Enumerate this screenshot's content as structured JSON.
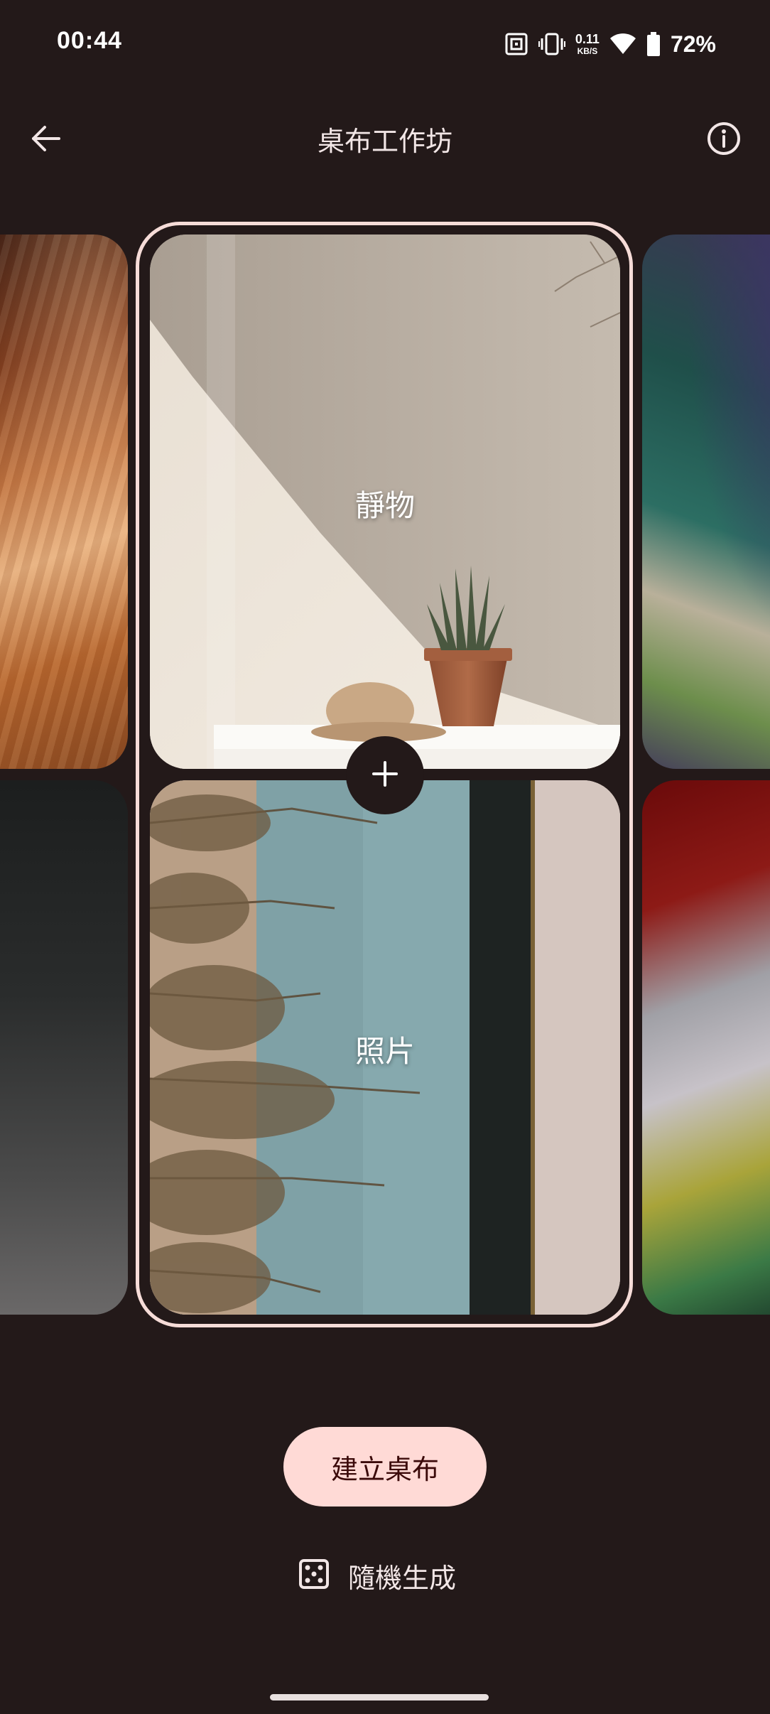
{
  "status_bar": {
    "time": "00:44",
    "net_speed_value": "0.11",
    "net_speed_unit": "KB/S",
    "battery_percent": "72%",
    "icons": [
      "nfc-icon",
      "vibrate-icon",
      "wifi-icon",
      "battery-icon"
    ]
  },
  "app_bar": {
    "title": "桌布工作坊",
    "back_icon": "arrow-back-icon",
    "info_icon": "info-icon"
  },
  "cards": [
    {
      "label": "靜物"
    },
    {
      "label": "照片"
    }
  ],
  "actions": {
    "create_label": "建立桌布",
    "random_label": "隨機生成",
    "random_icon": "dice-icon",
    "add_icon": "plus-icon"
  },
  "colors": {
    "background": "#231919",
    "accent_container": "#ffdad6",
    "frame_outline": "#f6dcd8"
  }
}
